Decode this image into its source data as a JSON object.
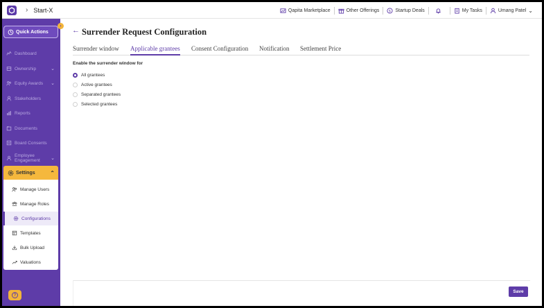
{
  "header": {
    "company": "Start-X",
    "links": [
      "Qapita Marketplace",
      "Other Offerings",
      "Startup Deals"
    ],
    "my_tasks": "My Tasks",
    "user": "Umang Patel"
  },
  "sidebar": {
    "quick_actions": "Quick Actions",
    "items": [
      {
        "label": "Dashboard",
        "icon": "chart-line-icon"
      },
      {
        "label": "Ownership",
        "icon": "ownership-icon",
        "expandable": true
      },
      {
        "label": "Equity Awards",
        "icon": "equity-icon",
        "expandable": true
      },
      {
        "label": "Stakeholders",
        "icon": "person-icon"
      },
      {
        "label": "Reports",
        "icon": "bar-chart-icon"
      },
      {
        "label": "Documents",
        "icon": "document-icon"
      },
      {
        "label": "Board Consents",
        "icon": "board-icon"
      },
      {
        "label": "Employee Engagement",
        "icon": "engagement-icon",
        "expandable": true
      }
    ],
    "settings": "Settings",
    "settings_items": [
      {
        "label": "Manage Users",
        "icon": "users-icon"
      },
      {
        "label": "Manage Roles",
        "icon": "roles-icon"
      },
      {
        "label": "Configurations",
        "icon": "gear-icon",
        "active": true
      },
      {
        "label": "Templates",
        "icon": "template-icon"
      },
      {
        "label": "Bulk Upload",
        "icon": "upload-icon"
      },
      {
        "label": "Valuations",
        "icon": "valuation-icon"
      }
    ]
  },
  "main": {
    "title": "Surrender Request Configuration",
    "tabs": [
      {
        "label": "Surrender window"
      },
      {
        "label": "Applicable grantees",
        "active": true
      },
      {
        "label": "Consent Configuration"
      },
      {
        "label": "Notification"
      },
      {
        "label": "Settlement Price"
      }
    ],
    "section_label": "Enable the surrender window for",
    "options": [
      {
        "label": "All grantees",
        "selected": true
      },
      {
        "label": "Active grantees"
      },
      {
        "label": "Separated grantees"
      },
      {
        "label": "Selected grantees"
      }
    ],
    "save_label": "Save"
  },
  "colors": {
    "brand": "#5e3ca8",
    "accent": "#f5b83d"
  }
}
